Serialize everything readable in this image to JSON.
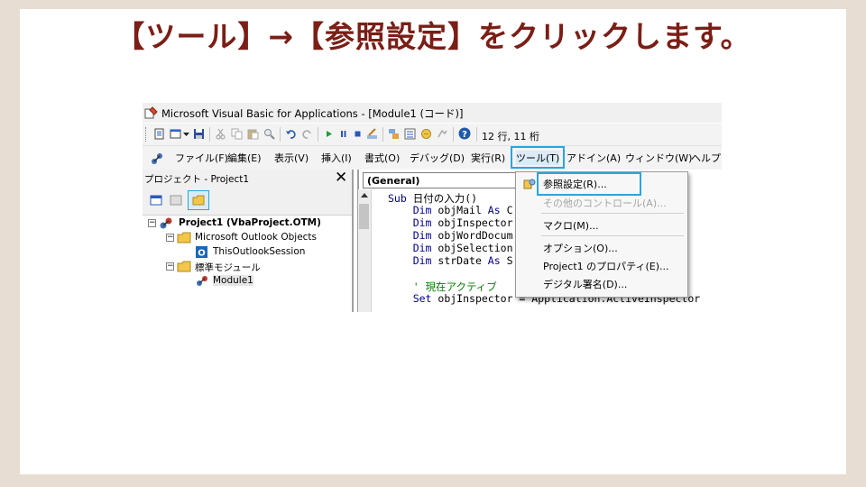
{
  "slide": {
    "title": "【ツール】→【参照設定】をクリックします。"
  },
  "window": {
    "title": "Microsoft Visual Basic for Applications - [Module1 (コード)]"
  },
  "toolbar": {
    "position": "12 行, 11 桁",
    "icons": [
      "document-icon",
      "form-icon",
      "dropdown-arrow-icon",
      "save-icon",
      "cut-icon",
      "copy-icon",
      "paste-icon",
      "find-icon",
      "undo-icon",
      "redo-icon",
      "run-icon",
      "pause-icon",
      "stop-icon",
      "design-mode-icon",
      "project-explorer-icon",
      "properties-icon",
      "object-browser-icon",
      "toolbox-icon",
      "help-icon"
    ]
  },
  "menubar": {
    "items": [
      "ファイル(F)",
      "編集(E)",
      "表示(V)",
      "挿入(I)",
      "書式(O)",
      "デバッグ(D)",
      "実行(R)",
      "ツール(T)",
      "アドイン(A)",
      "ウィンドウ(W)",
      "ヘルプ(H)"
    ]
  },
  "project": {
    "title": "プロジェクト - Project1",
    "close": "✕",
    "tree": [
      {
        "label": "Project1 (VbaProject.OTM)"
      },
      {
        "label": "Microsoft Outlook Objects"
      },
      {
        "label": "ThisOutlookSession"
      },
      {
        "label": "標準モジュール"
      },
      {
        "label": "Module1"
      }
    ]
  },
  "code": {
    "object_combo": "(General)",
    "lines": [
      "Sub 日付の入力()",
      "    Dim objMail As C",
      "    Dim objInspector",
      "    Dim objWordDocum",
      "    Dim objSelection",
      "    Dim strDate As S",
      "",
      "    ' 現在アクティブ",
      "    Set objInspector = Application.ActiveInspector"
    ]
  },
  "tools_menu": {
    "items": [
      {
        "label": "参照設定(R)...",
        "enabled": true
      },
      {
        "label": "その他のコントロール(A)...",
        "enabled": false
      },
      {
        "label": "マクロ(M)...",
        "enabled": true
      },
      {
        "label": "オプション(O)...",
        "enabled": true
      },
      {
        "label": "Project1 のプロパティ(E)...",
        "enabled": true
      },
      {
        "label": "デジタル署名(D)...",
        "enabled": true
      }
    ]
  },
  "colors": {
    "title_text": "#7a1e16",
    "highlight_border": "#29a6dc",
    "keyword": "#00008b",
    "comment": "#008000"
  }
}
